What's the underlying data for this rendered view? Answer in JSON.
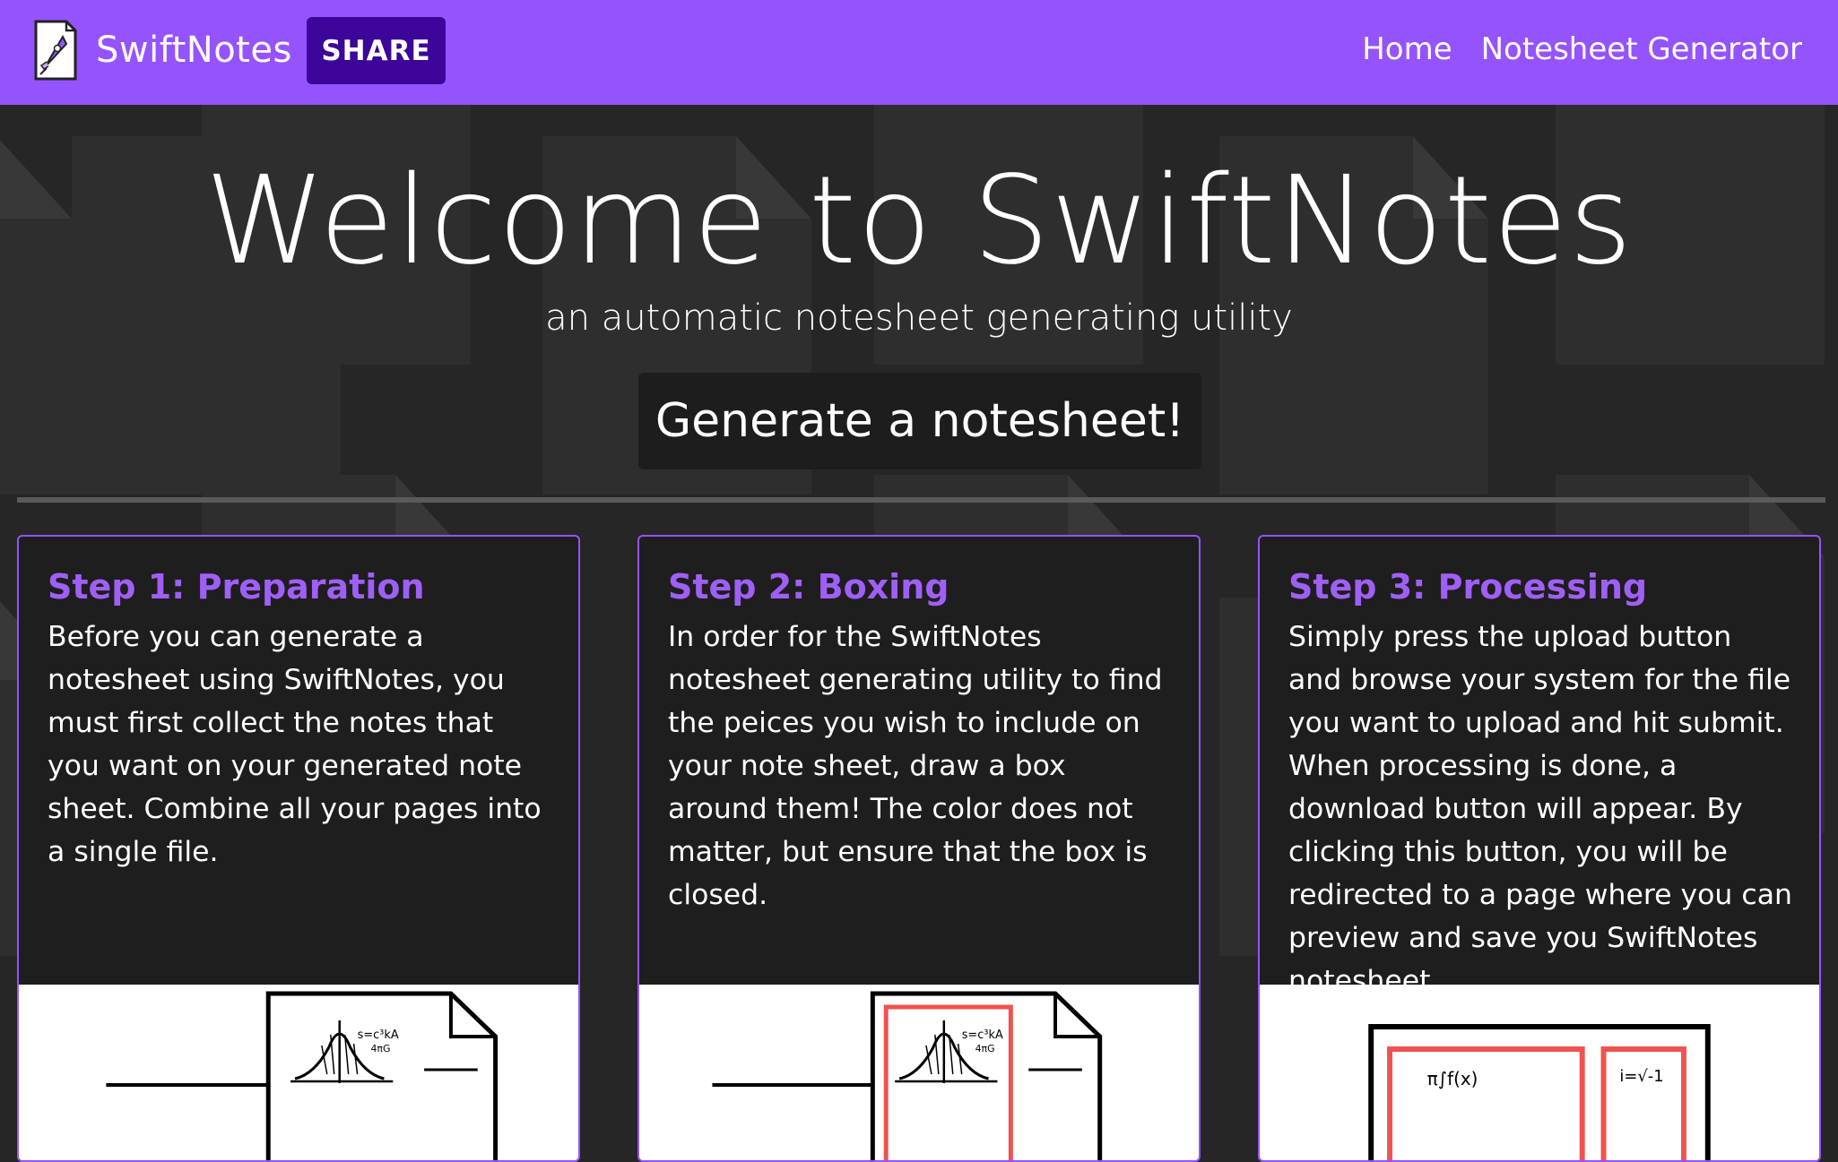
{
  "navbar": {
    "brand_name": "SwiftNotes",
    "share_label": "SHARE",
    "links": [
      {
        "label": "Home"
      },
      {
        "label": "Notesheet Generator"
      }
    ]
  },
  "hero": {
    "title": "Welcome to SwiftNotes",
    "subtitle": "an automatic notesheet generating utility",
    "cta_label": "Generate a notesheet!"
  },
  "steps": [
    {
      "title": "Step 1: Preparation",
      "text": "Before you can generate a notesheet using SwiftNotes, you must first collect the notes that you want on your generated note sheet. Combine all your pages into a single file."
    },
    {
      "title": "Step 2: Boxing",
      "text": "In order for the SwiftNotes notesheet generating utility to find the peices you wish to include on your note sheet, draw a box around them! The color does not matter, but ensure that the box is closed."
    },
    {
      "title": "Step 3: Processing",
      "text": "Simply press the upload button and browse your system for the file you want to upload and hit submit. When processing is done, a download button will appear. By clicking this button, you will be redirected to a page where you can preview and save you SwiftNotes notesheet."
    }
  ],
  "colors": {
    "navbar": "#9553fe",
    "share_button": "#3d0599",
    "step_title": "#9f5ff7",
    "background": "#262626",
    "card_background": "#1e1e1e",
    "box_highlight": "#ef5350"
  },
  "icons": {
    "brand_logo": "rocket-document-icon"
  }
}
